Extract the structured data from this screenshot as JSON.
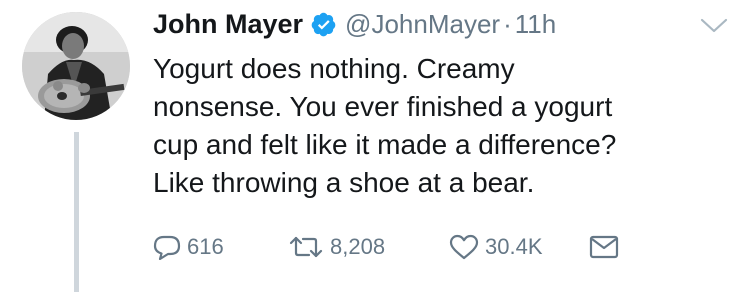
{
  "tweet": {
    "author": {
      "name": "John Mayer",
      "handle": "@JohnMayer",
      "verified": true
    },
    "time_separator": "·",
    "timestamp": "11h",
    "text": "Yogurt does nothing. Creamy\nnonsense. You ever finished a yogurt\ncup and felt like it made a difference?\nLike throwing a shoe at a bear.",
    "stats": {
      "replies": "616",
      "retweets": "8,208",
      "likes": "30.4K"
    }
  },
  "icons": {
    "verified": "verified-badge-icon",
    "menu": "chevron-down-icon",
    "reply": "reply-icon",
    "retweet": "retweet-icon",
    "like": "heart-icon",
    "message": "envelope-icon"
  },
  "colors": {
    "text": "#14171a",
    "secondary": "#657786",
    "verified": "#1da1f2",
    "thread_line": "#cfd6dc"
  }
}
